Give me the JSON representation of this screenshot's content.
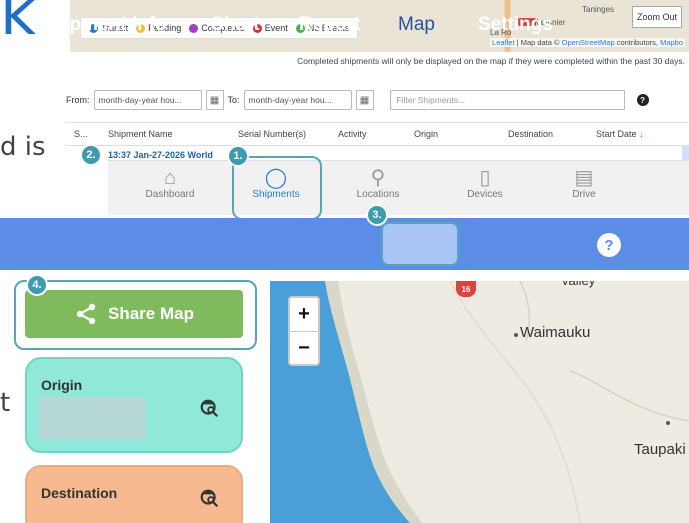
{
  "heading_fragment": "k",
  "body_fragment_1": "d is",
  "body_fragment_2": "t",
  "map_strip": {
    "legend": [
      {
        "label": "Transit",
        "color": "#2d7bd6"
      },
      {
        "label": "Pending",
        "color": "#f2c12e"
      },
      {
        "label": "Completed",
        "color": "#9b3fc7"
      },
      {
        "label": "Event",
        "color": "#d62f3a"
      },
      {
        "label": "No Events",
        "color": "#4bb04b"
      }
    ],
    "zoom_out_label": "Zoom Out",
    "place_1": "Taninges",
    "place_2": "Marignier",
    "place_3": "La Ro",
    "attribution_prefix": "",
    "attribution_leaflet": "Leaflet",
    "attribution_mid": " | Map data © ",
    "attribution_osm": "OpenStreetMap",
    "attribution_end": " contributors, ",
    "attribution_mapbox": "Mapbo",
    "note": "Completed shipments will only be displayed on the map if they were completed within the past 30 days."
  },
  "filters": {
    "from_label": "From:",
    "from_placeholder": "month-day-year hou...",
    "to_label": "To:",
    "to_placeholder": "month-day-year hou...",
    "search_placeholder": "Filter Shipments..."
  },
  "table": {
    "columns": [
      "S...",
      "Shipment Name",
      "Serial Number(s)",
      "Activity",
      "Origin",
      "Destination",
      "Start Date"
    ],
    "row_fragment": "13:37 Jan-27-2026 World"
  },
  "bottom_nav": [
    {
      "label": "Dashboard",
      "icon": "home-icon"
    },
    {
      "label": "Shipments",
      "icon": "ring-icon"
    },
    {
      "label": "Locations",
      "icon": "pin-icon"
    },
    {
      "label": "Devices",
      "icon": "phone-icon"
    },
    {
      "label": "Drive",
      "icon": "save-icon"
    }
  ],
  "tabs": [
    "Shipment Info",
    "Chart",
    "Report",
    "Map",
    "Settings"
  ],
  "help_label": "?",
  "steps": [
    "1.",
    "2.",
    "3.",
    "4."
  ],
  "share_button": "Share Map",
  "origin_title": "Origin",
  "destination_title": "Destination",
  "map": {
    "zoom_in": "+",
    "zoom_out": "−",
    "label_1": "Waimauku",
    "label_2": "Taupaki",
    "label_3": "valley",
    "road_number": "16"
  },
  "colors": {
    "tab_bar": "#5b8de6",
    "share_button": "#7fba5c",
    "origin_card": "#8fe8d8",
    "destination_card": "#f7b98f",
    "highlight": "#57a6b8",
    "sea": "#4a9fd8"
  }
}
